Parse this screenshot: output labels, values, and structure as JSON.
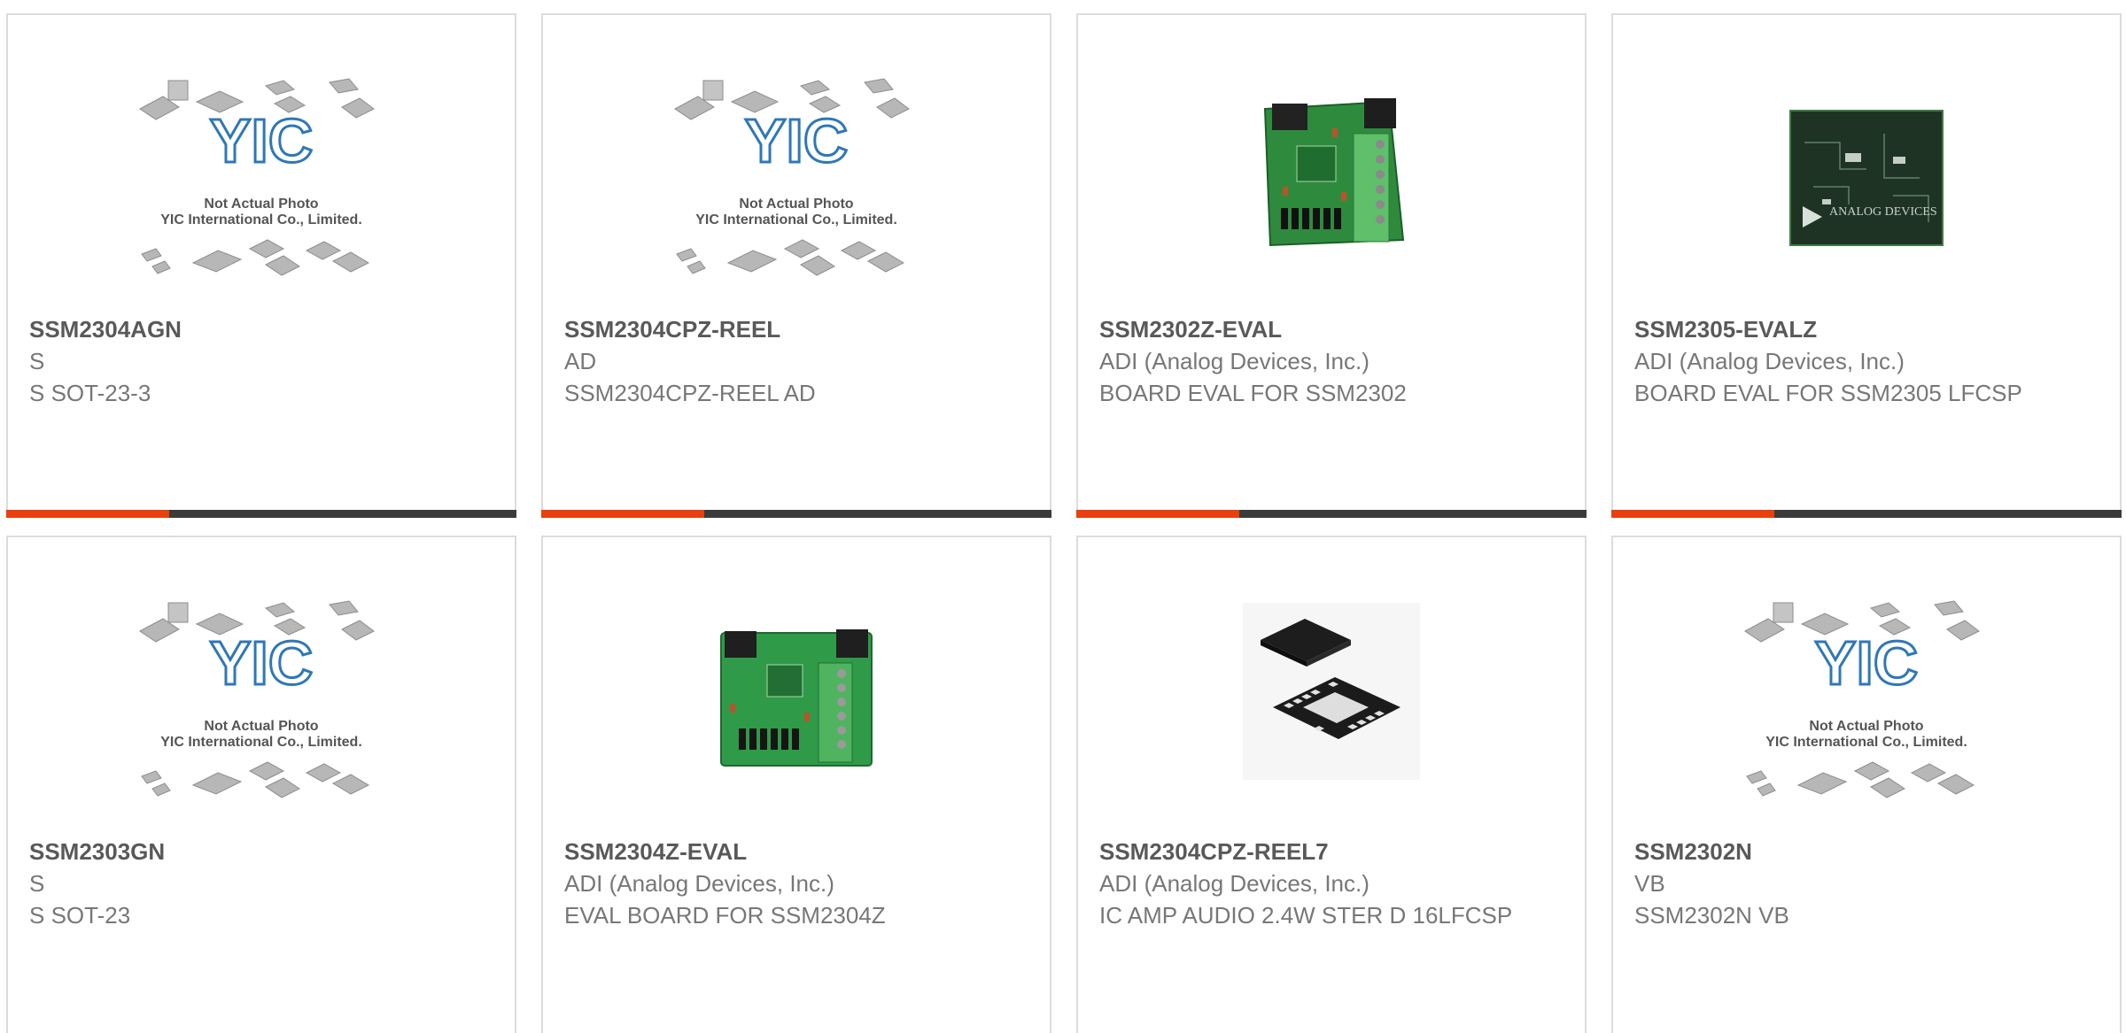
{
  "colors": {
    "accent": "#e8400f",
    "bar": "#3b3b3b",
    "text_dark": "#595959",
    "text_muted": "#777777",
    "yic_blue": "#2f77b7"
  },
  "placeholder_text": {
    "line1": "Not Actual Photo",
    "line2": "YIC International Co., Limited.",
    "logo": "YIC"
  },
  "products": [
    {
      "part": "SSM2304AGN",
      "mfr": "S",
      "desc": "S SOT-23-3",
      "image": "placeholder-image"
    },
    {
      "part": "SSM2304CPZ-REEL",
      "mfr": "AD",
      "desc": "SSM2304CPZ-REEL AD",
      "image": "placeholder-image"
    },
    {
      "part": "SSM2302Z-EVAL",
      "mfr": "ADI (Analog Devices, Inc.)",
      "desc": "BOARD EVAL FOR SSM2302",
      "image": "eval-board-photo"
    },
    {
      "part": "SSM2305-EVALZ",
      "mfr": "ADI (Analog Devices, Inc.)",
      "desc": "BOARD EVAL FOR SSM2305 LFCSP",
      "image": "dark-board-photo",
      "board_text": "ANALOG DEVICES"
    },
    {
      "part": "SSM2303GN",
      "mfr": "S",
      "desc": "S SOT-23",
      "image": "placeholder-image"
    },
    {
      "part": "SSM2304Z-EVAL",
      "mfr": "ADI (Analog Devices, Inc.)",
      "desc": "EVAL BOARD FOR SSM2304Z",
      "image": "eval-board-photo"
    },
    {
      "part": "SSM2304CPZ-REEL7",
      "mfr": "ADI (Analog Devices, Inc.)",
      "desc": "IC AMP AUDIO 2.4W STER D 16LFCSP",
      "image": "lfcsp-chip-photo"
    },
    {
      "part": "SSM2302N",
      "mfr": "VB",
      "desc": "SSM2302N VB",
      "image": "placeholder-image"
    }
  ]
}
